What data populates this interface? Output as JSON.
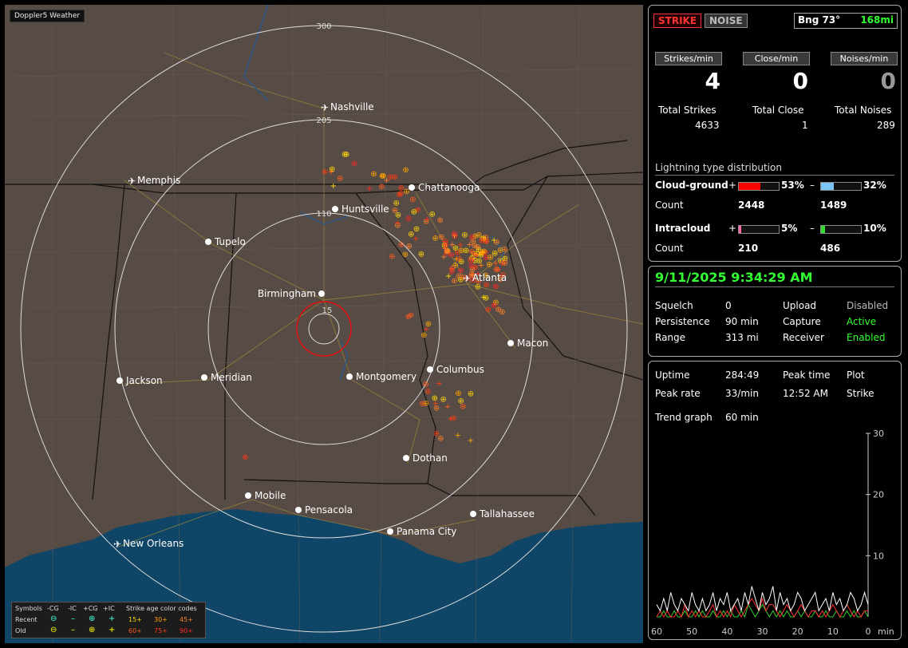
{
  "app": {
    "title": "Doppler5 Weather"
  },
  "map": {
    "range_labels": [
      "300",
      "205",
      "110",
      "15"
    ],
    "cities": [
      {
        "name": "Nashville",
        "airport": true
      },
      {
        "name": "Memphis",
        "airport": true
      },
      {
        "name": "Chattanooga",
        "airport": false
      },
      {
        "name": "Huntsville",
        "airport": false
      },
      {
        "name": "Tupelo",
        "airport": false
      },
      {
        "name": "Birmingham",
        "airport": false
      },
      {
        "name": "Atlanta",
        "airport": true
      },
      {
        "name": "Macon",
        "airport": false
      },
      {
        "name": "Jackson",
        "airport": false
      },
      {
        "name": "Meridian",
        "airport": false
      },
      {
        "name": "Montgomery",
        "airport": false
      },
      {
        "name": "Columbus",
        "airport": false
      },
      {
        "name": "Dothan",
        "airport": false
      },
      {
        "name": "Mobile",
        "airport": false
      },
      {
        "name": "Pensacola",
        "airport": false
      },
      {
        "name": "Tallahassee",
        "airport": false
      },
      {
        "name": "Panama City",
        "airport": false
      },
      {
        "name": "New Orleans",
        "airport": true
      }
    ],
    "legend": {
      "symbols_label": "Symbols",
      "headers": [
        "-CG",
        "-IC",
        "+CG",
        "+IC"
      ],
      "age_label": "Strike age color codes",
      "recent_label": "Recent",
      "old_label": "Old",
      "recent_ages": [
        "15+",
        "30+",
        "45+"
      ],
      "old_ages": [
        "60+",
        "75+",
        "90+"
      ],
      "age_colors": [
        "#ffd700",
        "#ffa500",
        "#ff7f27",
        "#ff5a1e",
        "#ff3c14",
        "#ff2a2a"
      ]
    }
  },
  "status": {
    "strike_tab": "STRIKE",
    "noise_tab": "NOISE",
    "bearing": "Bng 73°",
    "distance": "168mi",
    "strikes_min_label": "Strikes/min",
    "close_min_label": "Close/min",
    "noises_min_label": "Noises/min",
    "strikes_min": "4",
    "close_min": "0",
    "noises_min": "0",
    "total_strikes_label": "Total Strikes",
    "total_close_label": "Total Close",
    "total_noises_label": "Total Noises",
    "total_strikes": "4633",
    "total_close": "1",
    "total_noises": "289",
    "distribution_title": "Lightning type distribution",
    "cg_label": "Cloud-ground",
    "ic_label": "Intracloud",
    "count_label": "Count",
    "plus": "+",
    "minus": "–",
    "cg_pos_pct": "53%",
    "cg_pos_frac": 0.53,
    "cg_neg_pct": "32%",
    "cg_neg_frac": 0.32,
    "ic_pos_pct": "5%",
    "ic_pos_frac": 0.05,
    "ic_neg_pct": "10%",
    "ic_neg_frac": 0.1,
    "cg_pos_count": "2448",
    "cg_neg_count": "1489",
    "ic_pos_count": "210",
    "ic_neg_count": "486"
  },
  "settings": {
    "datetime": "9/11/2025 9:34:29 AM",
    "squelch_label": "Squelch",
    "squelch": "0",
    "upload_label": "Upload",
    "upload": "Disabled",
    "persistence_label": "Persistence",
    "persistence": "90 min",
    "capture_label": "Capture",
    "capture": "Active",
    "range_label": "Range",
    "range": "313 mi",
    "receiver_label": "Receiver",
    "receiver": "Enabled"
  },
  "stats": {
    "uptime_label": "Uptime",
    "uptime": "284:49",
    "peak_time_label": "Peak time",
    "plot_label": "Plot",
    "peak_rate_label": "Peak rate",
    "peak_rate": "33/min",
    "peak_time": "12:52 AM",
    "plot": "Strike",
    "trend_label": "Trend graph",
    "trend": "60 min",
    "y_ticks": [
      "30",
      "20",
      "10"
    ],
    "x_ticks": [
      "60",
      "50",
      "40",
      "30",
      "20",
      "10",
      "0"
    ],
    "x_unit": "min"
  },
  "chart_data": {
    "type": "line",
    "ylim": [
      0,
      30
    ],
    "x": [
      60,
      59,
      58,
      57,
      56,
      55,
      54,
      53,
      52,
      51,
      50,
      49,
      48,
      47,
      46,
      45,
      44,
      43,
      42,
      41,
      40,
      39,
      38,
      37,
      36,
      35,
      34,
      33,
      32,
      31,
      30,
      29,
      28,
      27,
      26,
      25,
      24,
      23,
      22,
      21,
      20,
      19,
      18,
      17,
      16,
      15,
      14,
      13,
      12,
      11,
      10,
      9,
      8,
      7,
      6,
      5,
      4,
      3,
      2,
      1,
      0
    ],
    "series": [
      {
        "color": "#ffffff",
        "values": [
          2,
          1,
          3,
          1,
          4,
          2,
          1,
          3,
          2,
          1,
          4,
          2,
          1,
          3,
          1,
          2,
          4,
          1,
          3,
          2,
          4,
          1,
          2,
          3,
          1,
          4,
          2,
          5,
          3,
          1,
          4,
          2,
          3,
          5,
          1,
          4,
          2,
          3,
          1,
          2,
          4,
          3,
          1,
          2,
          3,
          4,
          1,
          2,
          3,
          1,
          4,
          2,
          3,
          1,
          2,
          4,
          3,
          1,
          2,
          4,
          2
        ]
      },
      {
        "color": "#ff3030",
        "values": [
          0,
          1,
          0,
          1,
          0,
          0,
          1,
          0,
          2,
          0,
          1,
          0,
          1,
          0,
          0,
          1,
          2,
          0,
          1,
          0,
          1,
          0,
          2,
          1,
          0,
          1,
          2,
          3,
          2,
          1,
          3,
          1,
          2,
          2,
          1,
          0,
          1,
          2,
          1,
          0,
          1,
          2,
          1,
          0,
          1,
          1,
          0,
          1,
          0,
          1,
          2,
          1,
          0,
          1,
          2,
          1,
          0,
          1,
          0,
          1,
          1
        ]
      },
      {
        "color": "#30d030",
        "values": [
          0,
          0,
          1,
          0,
          0,
          1,
          0,
          0,
          1,
          0,
          0,
          1,
          0,
          1,
          0,
          0,
          1,
          0,
          0,
          1,
          0,
          1,
          0,
          0,
          1,
          0,
          2,
          1,
          0,
          1,
          2,
          1,
          0,
          1,
          0,
          1,
          0,
          1,
          0,
          0,
          1,
          0,
          1,
          0,
          0,
          1,
          0,
          0,
          1,
          0,
          0,
          1,
          0,
          0,
          1,
          0,
          1,
          0,
          0,
          1,
          0
        ]
      }
    ]
  }
}
